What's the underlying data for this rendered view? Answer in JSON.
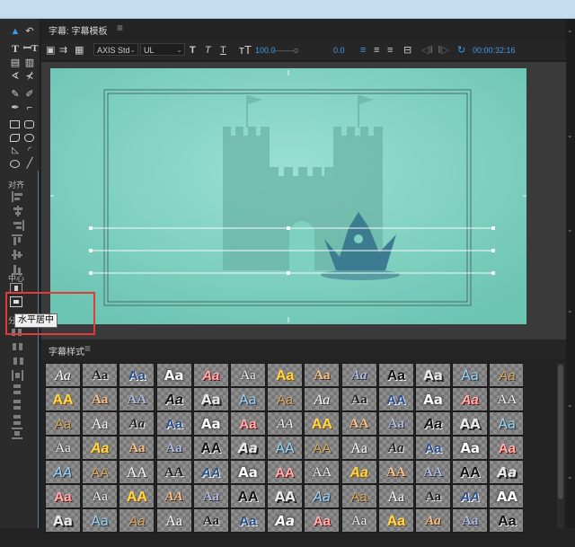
{
  "editor": {
    "title_tab": "字幕: 字幕模板",
    "styles_tab": "字幕样式",
    "menu_glyph": "≡"
  },
  "toolbar": {
    "font_family": "AXIS Std",
    "font_style": "UL",
    "font_size": "100.0",
    "kerning": "0.0",
    "timecode": "00:00:32:16"
  },
  "left_tools": {
    "align_label": "对齐",
    "center_label": "中心",
    "distribute_label": "分",
    "tooltip": "水平居中"
  },
  "colors": {
    "accent": "#3d9be9",
    "canvas": "#7ed0bf",
    "castle": "#6bb4a6",
    "crown": "#3d7b90",
    "highlight_box": "#e53935"
  },
  "styles": [
    [
      "Aa",
      "Aa",
      "Aa",
      "Aa",
      "Aa",
      "Aa",
      "Aa",
      "Aa",
      "Aa",
      "Aa",
      "Aa",
      "Aa",
      "Aa"
    ],
    [
      "AA",
      "Aa",
      "AA",
      "Aa",
      "Aa",
      "Aa",
      "Aa",
      "Aa",
      "Aa",
      "AA",
      "Aa",
      "Aa",
      "AA"
    ],
    [
      "Aa",
      "Aa",
      "Aa",
      "Aa",
      "Aa",
      "Aa",
      "AA",
      "AA",
      "AA",
      "Aa",
      "Aa",
      "AA",
      "Aa"
    ],
    [
      "Aa",
      "Aa",
      "Aa",
      "Aa",
      "AA",
      "Aa",
      "AA",
      "AA",
      "Aa",
      "Aa",
      "Aa",
      "Aa",
      "Aa"
    ],
    [
      "AA",
      "AA",
      "AA",
      "AA",
      "AA",
      "Aa",
      "AA",
      "AA",
      "Aa",
      "AA",
      "AA",
      "AA",
      "Aa"
    ],
    [
      "Aa",
      "Aa",
      "AA",
      "AA",
      "Aa",
      "AA",
      "AA",
      "Aa",
      "Aa",
      "Aa",
      "Aa",
      "AA",
      "AA"
    ],
    [
      "Aa",
      "Aa",
      "Aa",
      "Aa",
      "Aa",
      "Aa",
      "Aa",
      "Aa",
      "Aa",
      "Aa",
      "Aa",
      "Aa",
      "Aa"
    ]
  ]
}
